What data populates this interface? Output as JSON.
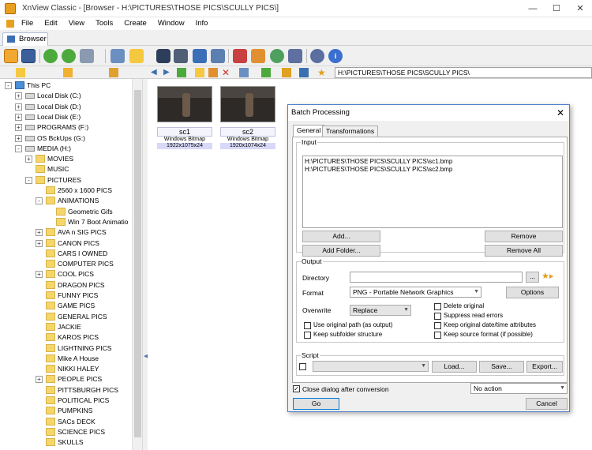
{
  "window": {
    "title": "XnView Classic - [Browser - H:\\PICTURES\\THOSE PICS\\SCULLY PICS\\]",
    "min": "—",
    "max": "☐",
    "close": "✕"
  },
  "menu": [
    "File",
    "Edit",
    "View",
    "Tools",
    "Create",
    "Window",
    "Info"
  ],
  "tab": {
    "label": "Browser"
  },
  "path": "H:\\PICTURES\\THOSE PICS\\SCULLY PICS\\",
  "tree": [
    {
      "label": "This PC",
      "level": 0,
      "icon": "pc",
      "expander": "-"
    },
    {
      "label": "Local Disk (C:)",
      "level": 1,
      "icon": "drive",
      "expander": "+"
    },
    {
      "label": "Local Disk (D:)",
      "level": 1,
      "icon": "drive",
      "expander": "+"
    },
    {
      "label": "Local Disk (E:)",
      "level": 1,
      "icon": "drive",
      "expander": "+"
    },
    {
      "label": "PROGRAMS (F:)",
      "level": 1,
      "icon": "drive",
      "expander": "+"
    },
    {
      "label": "OS BckUps (G:)",
      "level": 1,
      "icon": "drive",
      "expander": "+"
    },
    {
      "label": "MEDIA (H:)",
      "level": 1,
      "icon": "drive",
      "expander": "-"
    },
    {
      "label": "MOVIES",
      "level": 2,
      "icon": "folder",
      "expander": "+"
    },
    {
      "label": "MUSIC",
      "level": 2,
      "icon": "folder",
      "expander": ""
    },
    {
      "label": "PICTURES",
      "level": 2,
      "icon": "folder",
      "expander": "-"
    },
    {
      "label": "2560 x 1600 PICS",
      "level": 3,
      "icon": "folder",
      "expander": ""
    },
    {
      "label": "ANIMATIONS",
      "level": 3,
      "icon": "folder",
      "expander": "-"
    },
    {
      "label": "Geometric Gifs",
      "level": 4,
      "icon": "folder",
      "expander": ""
    },
    {
      "label": "Win 7 Boot Animatio",
      "level": 4,
      "icon": "folder",
      "expander": ""
    },
    {
      "label": "AVA n SIG PICS",
      "level": 3,
      "icon": "folder",
      "expander": "+"
    },
    {
      "label": "CANON PICS",
      "level": 3,
      "icon": "folder",
      "expander": "+"
    },
    {
      "label": "CARS I OWNED",
      "level": 3,
      "icon": "folder",
      "expander": ""
    },
    {
      "label": "COMPUTER PICS",
      "level": 3,
      "icon": "folder",
      "expander": ""
    },
    {
      "label": "COOL PICS",
      "level": 3,
      "icon": "folder",
      "expander": "+"
    },
    {
      "label": "DRAGON PICS",
      "level": 3,
      "icon": "folder",
      "expander": ""
    },
    {
      "label": "FUNNY PICS",
      "level": 3,
      "icon": "folder",
      "expander": ""
    },
    {
      "label": "GAME PICS",
      "level": 3,
      "icon": "folder",
      "expander": ""
    },
    {
      "label": "GENERAL PICS",
      "level": 3,
      "icon": "folder",
      "expander": ""
    },
    {
      "label": "JACKIE",
      "level": 3,
      "icon": "folder",
      "expander": ""
    },
    {
      "label": "KAROS PICS",
      "level": 3,
      "icon": "folder",
      "expander": ""
    },
    {
      "label": "LIGHTNING PICS",
      "level": 3,
      "icon": "folder",
      "expander": ""
    },
    {
      "label": "Mike A House",
      "level": 3,
      "icon": "folder",
      "expander": ""
    },
    {
      "label": "NIKKI HALEY",
      "level": 3,
      "icon": "folder",
      "expander": ""
    },
    {
      "label": "PEOPLE PICS",
      "level": 3,
      "icon": "folder",
      "expander": "+"
    },
    {
      "label": "PITTSBURGH PICS",
      "level": 3,
      "icon": "folder",
      "expander": ""
    },
    {
      "label": "POLITICAL PICS",
      "level": 3,
      "icon": "folder",
      "expander": ""
    },
    {
      "label": "PUMPKINS",
      "level": 3,
      "icon": "folder",
      "expander": ""
    },
    {
      "label": "SACs DECK",
      "level": 3,
      "icon": "folder",
      "expander": ""
    },
    {
      "label": "SCIENCE PICS",
      "level": 3,
      "icon": "folder",
      "expander": ""
    },
    {
      "label": "SKULLS",
      "level": 3,
      "icon": "folder",
      "expander": ""
    }
  ],
  "files": [
    {
      "name": "sc1",
      "type": "Windows Bitmap",
      "dims": "1922x1075x24"
    },
    {
      "name": "sc2",
      "type": "Windows Bitmap",
      "dims": "1920x1074x24"
    }
  ],
  "dialog": {
    "title": "Batch Processing",
    "tabs": [
      "General",
      "Transformations"
    ],
    "input_label": "Input",
    "input_files": [
      "H:\\PICTURES\\THOSE PICS\\SCULLY PICS\\sc1.bmp",
      "H:\\PICTURES\\THOSE PICS\\SCULLY PICS\\sc2.bmp"
    ],
    "add": "Add...",
    "add_folder": "Add Folder...",
    "remove": "Remove",
    "remove_all": "Remove All",
    "output_label": "Output",
    "directory_label": "Directory",
    "directory_value": "",
    "browse": "...",
    "format_label": "Format",
    "format_value": "PNG - Portable Network Graphics",
    "options": "Options",
    "overwrite_label": "Overwrite",
    "overwrite_value": "Replace",
    "delete_original": "Delete original",
    "suppress_errors": "Suppress read errors",
    "keep_datetime": "Keep original date/time attributes",
    "keep_source_format": "Keep source format (if possible)",
    "use_original_path": "Use original path (as output)",
    "keep_subfolder": "Keep subfolder structure",
    "script_label": "Script",
    "load": "Load...",
    "save": "Save...",
    "export": "Export...",
    "close_after": "Close dialog after conversion",
    "after_action": "No action",
    "go": "Go",
    "cancel": "Cancel"
  },
  "colors": {
    "dialog_border": "#4f7fc8",
    "selection": "#d8d8f8",
    "folder": "#f5d66b"
  }
}
